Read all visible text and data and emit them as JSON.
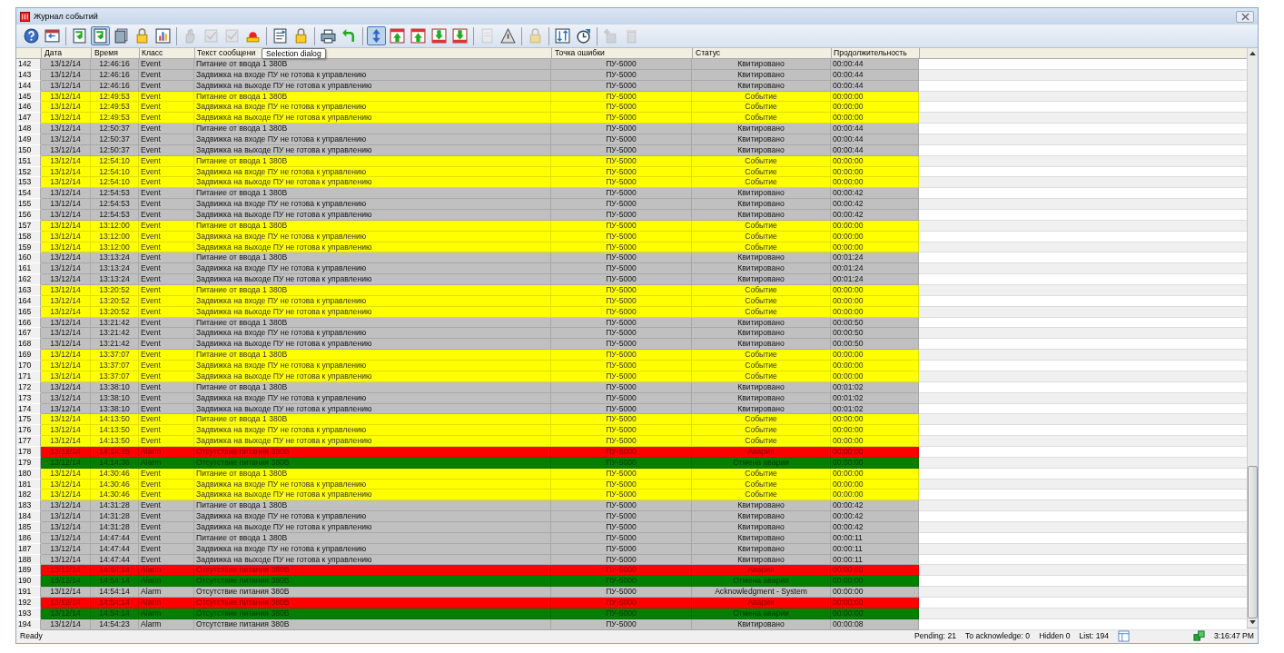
{
  "window": {
    "title": "Журнал событий"
  },
  "toolbar_groups": [
    [
      {
        "kind": "help",
        "disabled": false,
        "selected": false
      },
      {
        "kind": "window",
        "disabled": false,
        "selected": false
      }
    ],
    [
      {
        "kind": "doc-arrow",
        "disabled": false,
        "selected": false
      },
      {
        "kind": "doc-arrow",
        "disabled": false,
        "selected": true
      },
      {
        "kind": "pages",
        "disabled": false,
        "selected": false
      },
      {
        "kind": "lock",
        "disabled": false,
        "selected": false
      },
      {
        "kind": "chart",
        "disabled": false,
        "selected": false
      }
    ],
    [
      {
        "kind": "hand",
        "disabled": true,
        "selected": false
      },
      {
        "kind": "check",
        "disabled": true,
        "selected": false
      },
      {
        "kind": "check",
        "disabled": true,
        "selected": false
      },
      {
        "kind": "bell",
        "disabled": false,
        "selected": false
      }
    ],
    [
      {
        "kind": "list",
        "disabled": false,
        "selected": false
      },
      {
        "kind": "lock",
        "disabled": false,
        "selected": false
      }
    ],
    [
      {
        "kind": "printer",
        "disabled": false,
        "selected": false
      },
      {
        "kind": "undo",
        "disabled": false,
        "selected": false
      }
    ],
    [
      {
        "kind": "updown",
        "disabled": false,
        "selected": true
      },
      {
        "kind": "up",
        "disabled": false,
        "selected": false
      },
      {
        "kind": "up",
        "disabled": false,
        "selected": false
      },
      {
        "kind": "down",
        "disabled": false,
        "selected": false
      },
      {
        "kind": "down",
        "disabled": false,
        "selected": false
      }
    ],
    [
      {
        "kind": "doc",
        "disabled": true,
        "selected": false
      },
      {
        "kind": "warning",
        "disabled": false,
        "selected": false
      }
    ],
    [
      {
        "kind": "lock",
        "disabled": true,
        "selected": false
      }
    ],
    [
      {
        "kind": "sort",
        "disabled": false,
        "selected": false
      },
      {
        "kind": "clock",
        "disabled": false,
        "selected": false
      }
    ],
    [
      {
        "kind": "add",
        "disabled": true,
        "selected": false
      },
      {
        "kind": "trash",
        "disabled": true,
        "selected": false
      }
    ]
  ],
  "tooltip": "Selection dialog",
  "table": {
    "columns": [
      "Дата",
      "Время",
      "Класс",
      "Текст сообщени",
      "Точка ошибки",
      "Статус",
      "Продолжительность"
    ],
    "rows": [
      {
        "kind": "acknowledged",
        "num": "142",
        "date": "13/12/14",
        "time": "12:46:16",
        "class": "Event",
        "text": "Питание от ввода 1 380В",
        "point": "ПУ-5000",
        "status": "Квитировано",
        "duration": "00:00:44"
      },
      {
        "kind": "acknowledged",
        "num": "143",
        "date": "13/12/14",
        "time": "12:46:16",
        "class": "Event",
        "text": "Задвижка на входе ПУ не готова к управлению",
        "point": "ПУ-5000",
        "status": "Квитировано",
        "duration": "00:00:44"
      },
      {
        "kind": "acknowledged",
        "num": "144",
        "date": "13/12/14",
        "time": "12:46:16",
        "class": "Event",
        "text": "Задвижка на выходе ПУ не готова к управлению",
        "point": "ПУ-5000",
        "status": "Квитировано",
        "duration": "00:00:44"
      },
      {
        "kind": "event",
        "num": "145",
        "date": "13/12/14",
        "time": "12:49:53",
        "class": "Event",
        "text": "Питание от ввода 1 380В",
        "point": "ПУ-5000",
        "status": "Событие",
        "duration": "00:00:00"
      },
      {
        "kind": "event",
        "num": "146",
        "date": "13/12/14",
        "time": "12:49:53",
        "class": "Event",
        "text": "Задвижка на входе ПУ не готова к управлению",
        "point": "ПУ-5000",
        "status": "Событие",
        "duration": "00:00:00"
      },
      {
        "kind": "event",
        "num": "147",
        "date": "13/12/14",
        "time": "12:49:53",
        "class": "Event",
        "text": "Задвижка на выходе ПУ не готова к управлению",
        "point": "ПУ-5000",
        "status": "Событие",
        "duration": "00:00:00"
      },
      {
        "kind": "acknowledged",
        "num": "148",
        "date": "13/12/14",
        "time": "12:50:37",
        "class": "Event",
        "text": "Питание от ввода 1 380В",
        "point": "ПУ-5000",
        "status": "Квитировано",
        "duration": "00:00:44"
      },
      {
        "kind": "acknowledged",
        "num": "149",
        "date": "13/12/14",
        "time": "12:50:37",
        "class": "Event",
        "text": "Задвижка на входе ПУ не готова к управлению",
        "point": "ПУ-5000",
        "status": "Квитировано",
        "duration": "00:00:44"
      },
      {
        "kind": "acknowledged",
        "num": "150",
        "date": "13/12/14",
        "time": "12:50:37",
        "class": "Event",
        "text": "Задвижка на выходе ПУ не готова к управлению",
        "point": "ПУ-5000",
        "status": "Квитировано",
        "duration": "00:00:44"
      },
      {
        "kind": "event",
        "num": "151",
        "date": "13/12/14",
        "time": "12:54:10",
        "class": "Event",
        "text": "Питание от ввода 1 380В",
        "point": "ПУ-5000",
        "status": "Событие",
        "duration": "00:00:00"
      },
      {
        "kind": "event",
        "num": "152",
        "date": "13/12/14",
        "time": "12:54:10",
        "class": "Event",
        "text": "Задвижка на входе ПУ не готова к управлению",
        "point": "ПУ-5000",
        "status": "Событие",
        "duration": "00:00:00"
      },
      {
        "kind": "event",
        "num": "153",
        "date": "13/12/14",
        "time": "12:54:10",
        "class": "Event",
        "text": "Задвижка на выходе ПУ не готова к управлению",
        "point": "ПУ-5000",
        "status": "Событие",
        "duration": "00:00:00"
      },
      {
        "kind": "acknowledged",
        "num": "154",
        "date": "13/12/14",
        "time": "12:54:53",
        "class": "Event",
        "text": "Питание от ввода 1 380В",
        "point": "ПУ-5000",
        "status": "Квитировано",
        "duration": "00:00:42"
      },
      {
        "kind": "acknowledged",
        "num": "155",
        "date": "13/12/14",
        "time": "12:54:53",
        "class": "Event",
        "text": "Задвижка на входе ПУ не готова к управлению",
        "point": "ПУ-5000",
        "status": "Квитировано",
        "duration": "00:00:42"
      },
      {
        "kind": "acknowledged",
        "num": "156",
        "date": "13/12/14",
        "time": "12:54:53",
        "class": "Event",
        "text": "Задвижка на выходе ПУ не готова к управлению",
        "point": "ПУ-5000",
        "status": "Квитировано",
        "duration": "00:00:42"
      },
      {
        "kind": "event",
        "num": "157",
        "date": "13/12/14",
        "time": "13:12:00",
        "class": "Event",
        "text": "Питание от ввода 1 380В",
        "point": "ПУ-5000",
        "status": "Событие",
        "duration": "00:00:00"
      },
      {
        "kind": "event",
        "num": "158",
        "date": "13/12/14",
        "time": "13:12:00",
        "class": "Event",
        "text": "Задвижка на входе ПУ не готова к управлению",
        "point": "ПУ-5000",
        "status": "Событие",
        "duration": "00:00:00"
      },
      {
        "kind": "event",
        "num": "159",
        "date": "13/12/14",
        "time": "13:12:00",
        "class": "Event",
        "text": "Задвижка на выходе ПУ не готова к управлению",
        "point": "ПУ-5000",
        "status": "Событие",
        "duration": "00:00:00"
      },
      {
        "kind": "acknowledged",
        "num": "160",
        "date": "13/12/14",
        "time": "13:13:24",
        "class": "Event",
        "text": "Питание от ввода 1 380В",
        "point": "ПУ-5000",
        "status": "Квитировано",
        "duration": "00:01:24"
      },
      {
        "kind": "acknowledged",
        "num": "161",
        "date": "13/12/14",
        "time": "13:13:24",
        "class": "Event",
        "text": "Задвижка на входе ПУ не готова к управлению",
        "point": "ПУ-5000",
        "status": "Квитировано",
        "duration": "00:01:24"
      },
      {
        "kind": "acknowledged",
        "num": "162",
        "date": "13/12/14",
        "time": "13:13:24",
        "class": "Event",
        "text": "Задвижка на выходе ПУ не готова к управлению",
        "point": "ПУ-5000",
        "status": "Квитировано",
        "duration": "00:01:24"
      },
      {
        "kind": "event",
        "num": "163",
        "date": "13/12/14",
        "time": "13:20:52",
        "class": "Event",
        "text": "Питание от ввода 1 380В",
        "point": "ПУ-5000",
        "status": "Событие",
        "duration": "00:00:00"
      },
      {
        "kind": "event",
        "num": "164",
        "date": "13/12/14",
        "time": "13:20:52",
        "class": "Event",
        "text": "Задвижка на входе ПУ не готова к управлению",
        "point": "ПУ-5000",
        "status": "Событие",
        "duration": "00:00:00"
      },
      {
        "kind": "event",
        "num": "165",
        "date": "13/12/14",
        "time": "13:20:52",
        "class": "Event",
        "text": "Задвижка на выходе ПУ не готова к управлению",
        "point": "ПУ-5000",
        "status": "Событие",
        "duration": "00:00:00"
      },
      {
        "kind": "acknowledged",
        "num": "166",
        "date": "13/12/14",
        "time": "13:21:42",
        "class": "Event",
        "text": "Питание от ввода 1 380В",
        "point": "ПУ-5000",
        "status": "Квитировано",
        "duration": "00:00:50"
      },
      {
        "kind": "acknowledged",
        "num": "167",
        "date": "13/12/14",
        "time": "13:21:42",
        "class": "Event",
        "text": "Задвижка на входе ПУ не готова к управлению",
        "point": "ПУ-5000",
        "status": "Квитировано",
        "duration": "00:00:50"
      },
      {
        "kind": "acknowledged",
        "num": "168",
        "date": "13/12/14",
        "time": "13:21:42",
        "class": "Event",
        "text": "Задвижка на выходе ПУ не готова к управлению",
        "point": "ПУ-5000",
        "status": "Квитировано",
        "duration": "00:00:50"
      },
      {
        "kind": "event",
        "num": "169",
        "date": "13/12/14",
        "time": "13:37:07",
        "class": "Event",
        "text": "Питание от ввода 1 380В",
        "point": "ПУ-5000",
        "status": "Событие",
        "duration": "00:00:00"
      },
      {
        "kind": "event",
        "num": "170",
        "date": "13/12/14",
        "time": "13:37:07",
        "class": "Event",
        "text": "Задвижка на входе ПУ не готова к управлению",
        "point": "ПУ-5000",
        "status": "Событие",
        "duration": "00:00:00"
      },
      {
        "kind": "event",
        "num": "171",
        "date": "13/12/14",
        "time": "13:37:07",
        "class": "Event",
        "text": "Задвижка на выходе ПУ не готова к управлению",
        "point": "ПУ-5000",
        "status": "Событие",
        "duration": "00:00:00"
      },
      {
        "kind": "acknowledged",
        "num": "172",
        "date": "13/12/14",
        "time": "13:38:10",
        "class": "Event",
        "text": "Питание от ввода 1 380В",
        "point": "ПУ-5000",
        "status": "Квитировано",
        "duration": "00:01:02"
      },
      {
        "kind": "acknowledged",
        "num": "173",
        "date": "13/12/14",
        "time": "13:38:10",
        "class": "Event",
        "text": "Задвижка на входе ПУ не готова к управлению",
        "point": "ПУ-5000",
        "status": "Квитировано",
        "duration": "00:01:02"
      },
      {
        "kind": "acknowledged",
        "num": "174",
        "date": "13/12/14",
        "time": "13:38:10",
        "class": "Event",
        "text": "Задвижка на выходе ПУ не готова к управлению",
        "point": "ПУ-5000",
        "status": "Квитировано",
        "duration": "00:01:02"
      },
      {
        "kind": "event",
        "num": "175",
        "date": "13/12/14",
        "time": "14:13:50",
        "class": "Event",
        "text": "Питание от ввода 1 380В",
        "point": "ПУ-5000",
        "status": "Событие",
        "duration": "00:00:00"
      },
      {
        "kind": "event",
        "num": "176",
        "date": "13/12/14",
        "time": "14:13:50",
        "class": "Event",
        "text": "Задвижка на входе ПУ не готова к управлению",
        "point": "ПУ-5000",
        "status": "Событие",
        "duration": "00:00:00"
      },
      {
        "kind": "event",
        "num": "177",
        "date": "13/12/14",
        "time": "14:13:50",
        "class": "Event",
        "text": "Задвижка на выходе ПУ не готова к управлению",
        "point": "ПУ-5000",
        "status": "Событие",
        "duration": "00:00:00"
      },
      {
        "kind": "alarm",
        "num": "178",
        "date": "13/12/14",
        "time": "14:14:35",
        "class": "Alarm",
        "text": "Отсутствие питания 380В",
        "point": "ПУ-5000",
        "status": "Авария",
        "duration": "00:00:00"
      },
      {
        "kind": "cleared",
        "num": "179",
        "date": "13/12/14",
        "time": "14:14:36",
        "class": "Alarm",
        "text": "Отсутствие питания 380В",
        "point": "ПУ-5000",
        "status": "Отмена аварии",
        "duration": "00:00:00"
      },
      {
        "kind": "event",
        "num": "180",
        "date": "13/12/14",
        "time": "14:30:46",
        "class": "Event",
        "text": "Питание от ввода 1 380В",
        "point": "ПУ-5000",
        "status": "Событие",
        "duration": "00:00:00"
      },
      {
        "kind": "event",
        "num": "181",
        "date": "13/12/14",
        "time": "14:30:46",
        "class": "Event",
        "text": "Задвижка на входе ПУ не готова к управлению",
        "point": "ПУ-5000",
        "status": "Событие",
        "duration": "00:00:00"
      },
      {
        "kind": "event",
        "num": "182",
        "date": "13/12/14",
        "time": "14:30:46",
        "class": "Event",
        "text": "Задвижка на выходе ПУ не готова к управлению",
        "point": "ПУ-5000",
        "status": "Событие",
        "duration": "00:00:00"
      },
      {
        "kind": "acknowledged",
        "num": "183",
        "date": "13/12/14",
        "time": "14:31:28",
        "class": "Event",
        "text": "Питание от ввода 1 380В",
        "point": "ПУ-5000",
        "status": "Квитировано",
        "duration": "00:00:42"
      },
      {
        "kind": "acknowledged",
        "num": "184",
        "date": "13/12/14",
        "time": "14:31:28",
        "class": "Event",
        "text": "Задвижка на входе ПУ не готова к управлению",
        "point": "ПУ-5000",
        "status": "Квитировано",
        "duration": "00:00:42"
      },
      {
        "kind": "acknowledged",
        "num": "185",
        "date": "13/12/14",
        "time": "14:31:28",
        "class": "Event",
        "text": "Задвижка на выходе ПУ не готова к управлению",
        "point": "ПУ-5000",
        "status": "Квитировано",
        "duration": "00:00:42"
      },
      {
        "kind": "acknowledged",
        "num": "186",
        "date": "13/12/14",
        "time": "14:47:44",
        "class": "Event",
        "text": "Питание от ввода 1 380В",
        "point": "ПУ-5000",
        "status": "Квитировано",
        "duration": "00:00:11"
      },
      {
        "kind": "acknowledged",
        "num": "187",
        "date": "13/12/14",
        "time": "14:47:44",
        "class": "Event",
        "text": "Задвижка на входе ПУ не готова к управлению",
        "point": "ПУ-5000",
        "status": "Квитировано",
        "duration": "00:00:11"
      },
      {
        "kind": "acknowledged",
        "num": "188",
        "date": "13/12/14",
        "time": "14:47:44",
        "class": "Event",
        "text": "Задвижка на выходе ПУ не готова к управлению",
        "point": "ПУ-5000",
        "status": "Квитировано",
        "duration": "00:00:11"
      },
      {
        "kind": "alarm",
        "num": "189",
        "date": "13/12/14",
        "time": "14:54:14",
        "class": "Alarm",
        "text": "Отсутствие питания 380В",
        "point": "ПУ-5000",
        "status": "Авария",
        "duration": "00:00:00"
      },
      {
        "kind": "cleared",
        "num": "190",
        "date": "13/12/14",
        "time": "14:54:14",
        "class": "Alarm",
        "text": "Отсутствие питания 380В",
        "point": "ПУ-5000",
        "status": "Отмена аварии",
        "duration": "00:00:00"
      },
      {
        "kind": "acknowledged",
        "num": "191",
        "date": "13/12/14",
        "time": "14:54:14",
        "class": "Alarm",
        "text": "Отсутствие питания 380В",
        "point": "ПУ-5000",
        "status": "Acknowledgment - System",
        "duration": "00:00:00"
      },
      {
        "kind": "alarm",
        "num": "192",
        "date": "13/12/14",
        "time": "14:54:14",
        "class": "Alarm",
        "text": "Отсутствие питания 380В",
        "point": "ПУ-5000",
        "status": "Авария",
        "duration": "00:00:00"
      },
      {
        "kind": "cleared",
        "num": "193",
        "date": "13/12/14",
        "time": "14:54:14",
        "class": "Alarm",
        "text": "Отсутствие питания 380В",
        "point": "ПУ-5000",
        "status": "Отмена аварии",
        "duration": "00:00:00"
      },
      {
        "kind": "acknowledged",
        "num": "194",
        "date": "13/12/14",
        "time": "14:54:23",
        "class": "Alarm",
        "text": "Отсутствие питания 380В",
        "point": "ПУ-5000",
        "status": "Квитировано",
        "duration": "00:00:08"
      }
    ]
  },
  "status_bar": {
    "message": "Ready",
    "pending": "Pending: 21",
    "to_acknowledge": "To acknowledge: 0",
    "hidden": "Hidden 0",
    "list": "List: 194",
    "time": "3:16:47 PM"
  }
}
